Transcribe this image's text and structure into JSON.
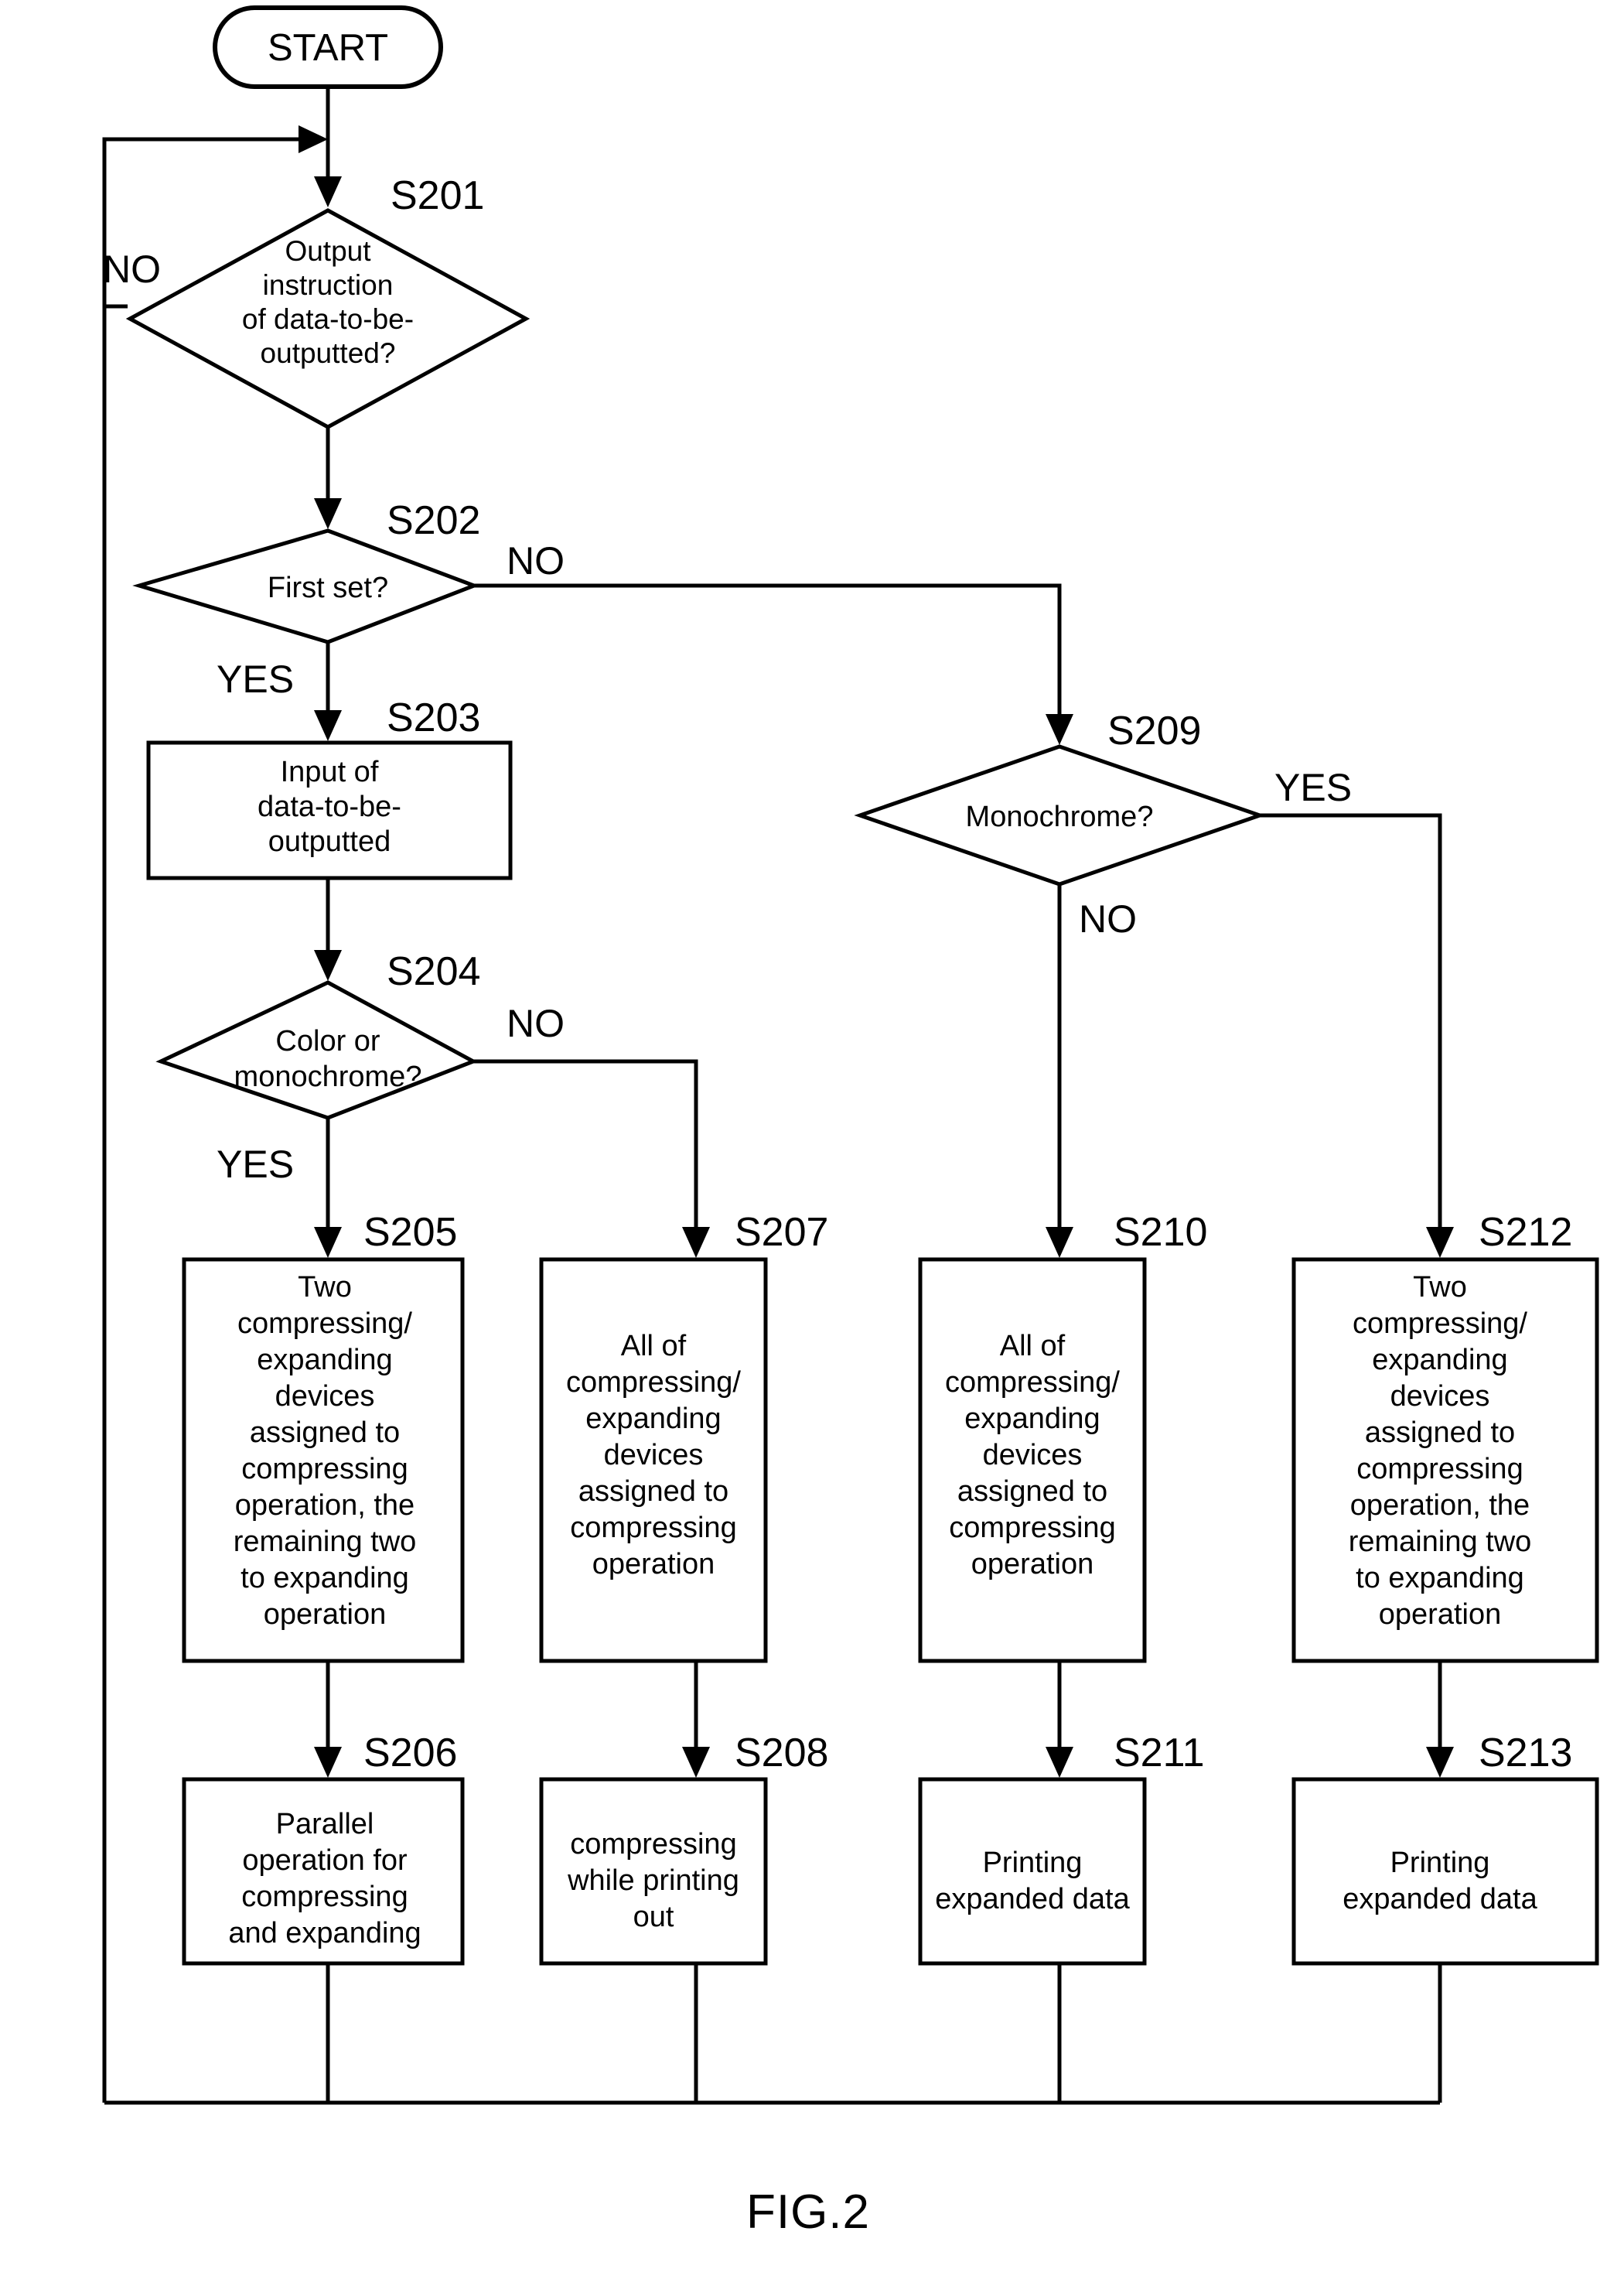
{
  "figure": {
    "caption": "FIG.2"
  },
  "nodes": {
    "start": {
      "id": "",
      "label": "START",
      "type": "terminator"
    },
    "s201": {
      "id": "S201",
      "type": "decision",
      "lines": [
        "Output",
        "instruction",
        "of data-to-be-",
        "outputted?"
      ],
      "branch_no": "NO"
    },
    "s202": {
      "id": "S202",
      "type": "decision",
      "lines": [
        "First set?"
      ],
      "branch_no": "NO",
      "branch_yes": "YES"
    },
    "s203": {
      "id": "S203",
      "type": "process",
      "lines": [
        "Input of",
        "data-to-be-",
        "outputted"
      ]
    },
    "s204": {
      "id": "S204",
      "type": "decision",
      "lines": [
        "Color or",
        "monochrome?"
      ],
      "branch_no": "NO",
      "branch_yes": "YES"
    },
    "s205": {
      "id": "S205",
      "type": "process",
      "lines": [
        "Two",
        "compressing/",
        "expanding",
        "devices",
        "assigned to",
        "compressing",
        "operation, the",
        "remaining two",
        "to expanding",
        "operation"
      ]
    },
    "s206": {
      "id": "S206",
      "type": "process",
      "lines": [
        "Parallel",
        "operation for",
        "compressing",
        "and expanding"
      ]
    },
    "s207": {
      "id": "S207",
      "type": "process",
      "lines": [
        "All of",
        "compressing/",
        "expanding",
        "devices",
        "assigned to",
        "compressing",
        "operation"
      ]
    },
    "s208": {
      "id": "S208",
      "type": "process",
      "lines": [
        "compressing",
        "while printing",
        "out"
      ]
    },
    "s209": {
      "id": "S209",
      "type": "decision",
      "lines": [
        "Monochrome?"
      ],
      "branch_no": "NO",
      "branch_yes": "YES"
    },
    "s210": {
      "id": "S210",
      "type": "process",
      "lines": [
        "All of",
        "compressing/",
        "expanding",
        "devices",
        "assigned to",
        "compressing",
        "operation"
      ]
    },
    "s211": {
      "id": "S211",
      "type": "process",
      "lines": [
        "Printing",
        "expanded data"
      ]
    },
    "s212": {
      "id": "S212",
      "type": "process",
      "lines": [
        "Two",
        "compressing/",
        "expanding",
        "devices",
        "assigned to",
        "compressing",
        "operation, the",
        "remaining two",
        "to expanding",
        "operation"
      ]
    },
    "s213": {
      "id": "S213",
      "type": "process",
      "lines": [
        "Printing",
        "expanded data"
      ]
    }
  },
  "colors": {
    "stroke": "#000000",
    "fill": "#ffffff",
    "text": "#000000"
  }
}
